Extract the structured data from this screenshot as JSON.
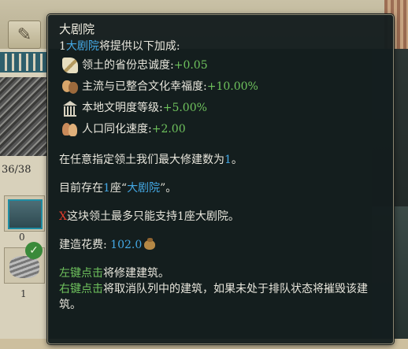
{
  "background": {
    "scroll_icon": "scroll-icon",
    "counter": "36/38",
    "slot_counts": [
      "0",
      "1"
    ],
    "check_glyph": "✓"
  },
  "tooltip": {
    "title": "大剧院",
    "intro": {
      "prefix": "1",
      "building": "大剧院",
      "suffix": "将提供以下加成:"
    },
    "bonuses": [
      {
        "icon": "quill-icon",
        "label": "领土的省份忠诚度:",
        "value": "+0.05"
      },
      {
        "icon": "theater-masks-icon",
        "label": "主流与已整合文化幸福度:",
        "value": "+10.00%"
      },
      {
        "icon": "temple-icon",
        "label": "本地文明度等级:",
        "value": "+5.00%"
      },
      {
        "icon": "people-icon",
        "label": "人口同化速度:",
        "value": "+2.00"
      }
    ],
    "max_build": {
      "text": "在任意指定领土我们最大修建数为",
      "value": "1",
      "end": "。"
    },
    "existing": {
      "prefix": "目前存在",
      "count": "1",
      "mid": "座“",
      "building": "大剧院",
      "end": "”。"
    },
    "limit": {
      "mark": "X",
      "text": "这块领土最多只能支持1座大剧院。"
    },
    "cost": {
      "label": "建造花费:",
      "value": "102.0",
      "icon": "money-bag-icon"
    },
    "actions": [
      {
        "key": "左键点击",
        "text": "将修建建筑。"
      },
      {
        "key": "右键点击",
        "text": "将取消队列中的建筑，如果未处于排队状态将摧毁该建筑。"
      }
    ]
  },
  "colors": {
    "highlight_blue": "#44a8e4",
    "positive_green": "#6fc35d",
    "error_red": "#e23c2c",
    "panel_bg": "#141d1e"
  }
}
